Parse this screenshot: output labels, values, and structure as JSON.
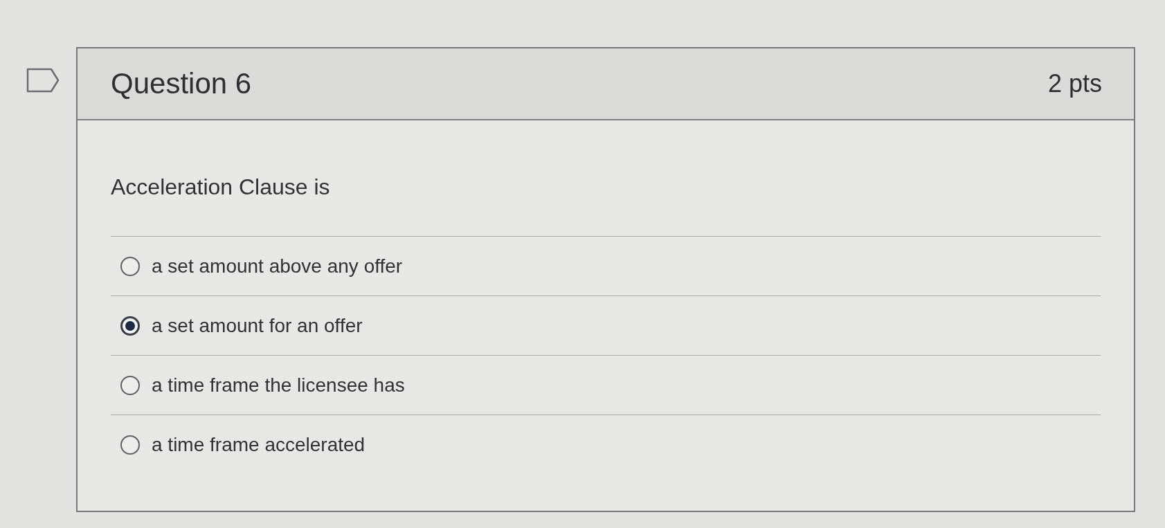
{
  "question": {
    "title": "Question 6",
    "points": "2 pts",
    "prompt": "Acceleration Clause is",
    "answers": [
      {
        "label": "a set amount above any offer",
        "selected": false
      },
      {
        "label": "a set amount for an offer",
        "selected": true
      },
      {
        "label": "a time frame the licensee has",
        "selected": false
      },
      {
        "label": "a time frame accelerated",
        "selected": false
      }
    ]
  }
}
